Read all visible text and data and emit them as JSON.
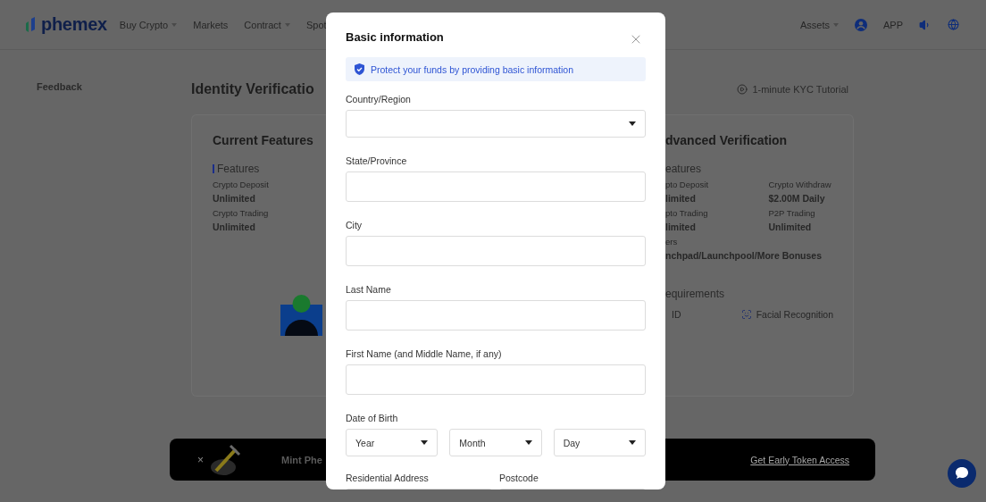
{
  "header": {
    "logo": "phemex",
    "nav": [
      {
        "label": "Buy Crypto",
        "dropdown": true
      },
      {
        "label": "Markets",
        "dropdown": false
      },
      {
        "label": "Contract",
        "dropdown": true
      },
      {
        "label": "Spot",
        "dropdown": false
      }
    ],
    "assets": {
      "label": "Assets",
      "dropdown": true
    },
    "app": "APP"
  },
  "sidebar": {
    "items": [
      {
        "label": "Feedback"
      }
    ]
  },
  "page": {
    "title": "Identity Verificatio",
    "tutorial": "1-minute KYC Tutorial",
    "current_card": {
      "title": "Current Features",
      "section": "Features",
      "features": [
        {
          "label": "Crypto Deposit",
          "value": "Unlimited"
        },
        {
          "label": "Crypto Trading",
          "value": "Unlimited"
        }
      ]
    },
    "advanced_card": {
      "title": "dvanced Verification",
      "section": "eatures",
      "columns": [
        [
          {
            "label": "pto Deposit",
            "value": "limited"
          },
          {
            "label": "pto Trading",
            "value": "limited"
          },
          {
            "label": "ers"
          }
        ],
        [
          {
            "label": "Crypto Withdraw",
            "value": "$2.00M Daily"
          },
          {
            "label": "P2P Trading",
            "value": "Unlimited"
          }
        ]
      ],
      "bonus": "nchpad/Launchpool/More Bonuses",
      "requirements_title": "equirements",
      "requirements": [
        {
          "kind": "id",
          "label": "ID"
        },
        {
          "kind": "face",
          "label": "Facial Recognition"
        }
      ]
    }
  },
  "banner": {
    "close": "×",
    "title": "Mint Phe",
    "link": "Get Early Token Access"
  },
  "modal": {
    "title": "Basic information",
    "notice": "Protect your funds by providing basic information",
    "fields": [
      {
        "kind": "select",
        "label": "Country/Region"
      },
      {
        "kind": "input",
        "label": "State/Province"
      },
      {
        "kind": "input",
        "label": "City"
      },
      {
        "kind": "input",
        "label": "Last Name"
      },
      {
        "kind": "input",
        "label": "First Name (and Middle Name, if any)"
      },
      {
        "kind": "selects",
        "label": "Date of Birth",
        "options": [
          {
            "placeholder": "Year"
          },
          {
            "placeholder": "Month"
          },
          {
            "placeholder": "Day"
          }
        ]
      },
      {
        "kind": "pair",
        "items": [
          {
            "label": "Residential Address"
          },
          {
            "label": "Postcode"
          }
        ]
      }
    ]
  }
}
